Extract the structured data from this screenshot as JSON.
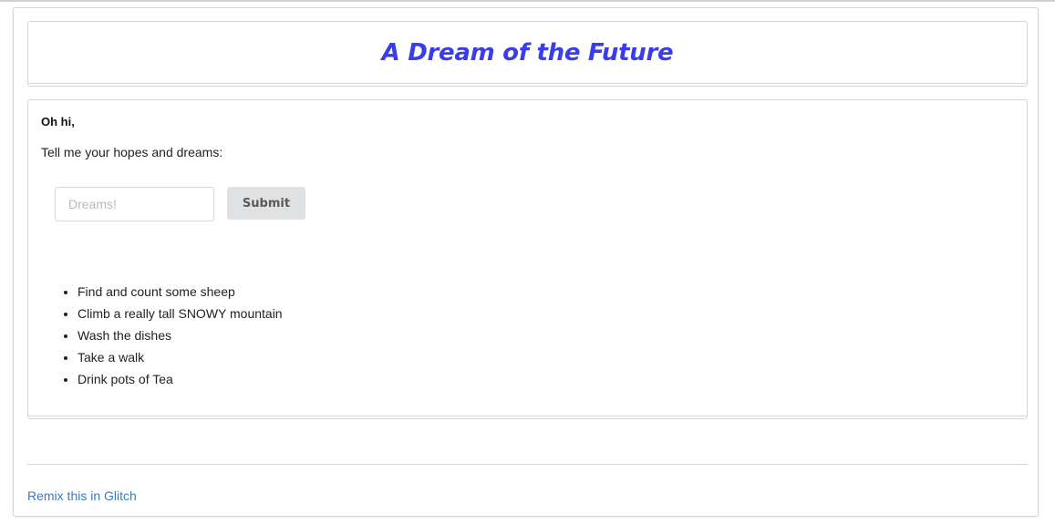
{
  "header": {
    "title": "A Dream of the Future"
  },
  "main": {
    "greeting": "Oh hi,",
    "prompt": "Tell me your hopes and dreams:",
    "form": {
      "input_placeholder": "Dreams!",
      "input_value": "",
      "submit_label": "Submit"
    },
    "dreams": [
      "Find and count some sheep",
      "Climb a really tall SNOWY mountain",
      "Wash the dishes",
      "Take a walk",
      "Drink pots of Tea"
    ]
  },
  "footer": {
    "link_text": "Remix this in Glitch"
  },
  "colors": {
    "title": "#3a3ee8",
    "link": "#3b7bbf",
    "button_bg": "#e0e1e2",
    "border": "#d4d4d5"
  }
}
